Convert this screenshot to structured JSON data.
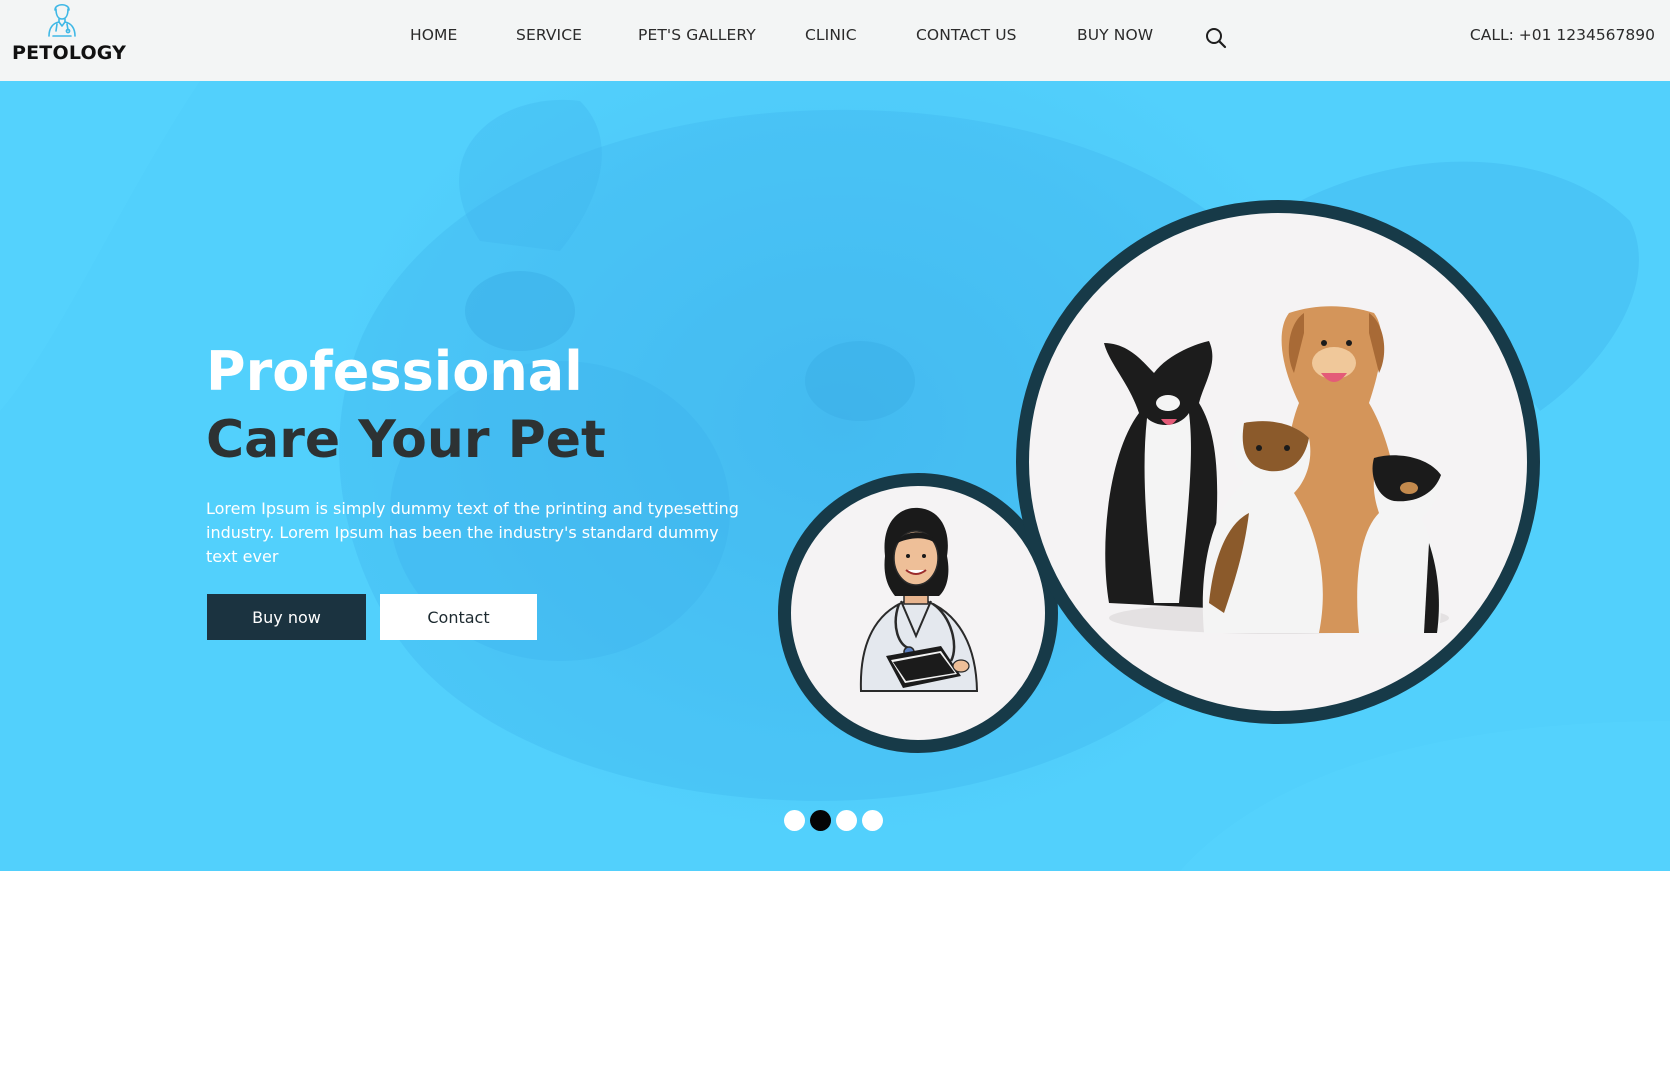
{
  "brand": {
    "name": "PETOLOGY",
    "logo_icon": "veterinarian-icon"
  },
  "nav": {
    "items": [
      {
        "label": "HOME"
      },
      {
        "label": "SERVICE"
      },
      {
        "label": "PET'S GALLERY"
      },
      {
        "label": "CLINIC"
      },
      {
        "label": "CONTACT US"
      },
      {
        "label": "BUY NOW"
      }
    ],
    "search_icon": "search-icon",
    "call_text": "CALL: +01 1234567890"
  },
  "hero": {
    "title_line1": "Professional",
    "title_line2": "Care Your Pet",
    "description": "Lorem Ipsum is simply dummy text of the printing and typesetting industry. Lorem Ipsum has been the industry's standard dummy text ever",
    "buy_button": "Buy now",
    "contact_button": "Contact",
    "slider": {
      "total": 4,
      "active_index": 2
    }
  },
  "colors": {
    "hero_bg": "#52d0fc",
    "header_bg": "#f3f5f5",
    "dark_accent": "#173a48",
    "button_dark": "#1b3340"
  }
}
